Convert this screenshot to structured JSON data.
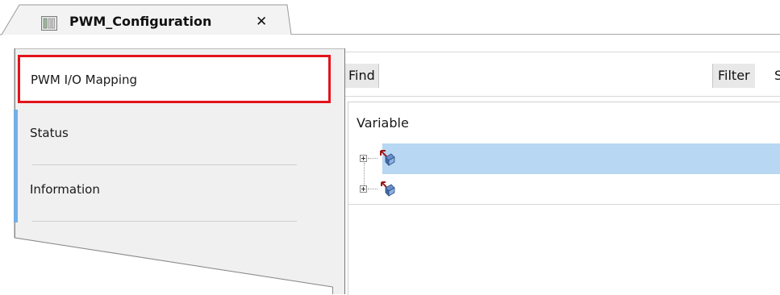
{
  "editor": {
    "tab_title": "PWM_Configuration",
    "tab_icon": "device-config-icon",
    "close_icon": "close-icon"
  },
  "side_tabs": [
    {
      "label": "PWM I/O Mapping",
      "active": true
    },
    {
      "label": "Status",
      "active": false
    },
    {
      "label": "Information",
      "active": false
    }
  ],
  "toolbar": {
    "find_label": "Find",
    "find_value": "",
    "filter_label": "Filter",
    "filter_value": "S"
  },
  "grid": {
    "column_header": "Variable",
    "rows": [
      {
        "icon": "output-channel-icon",
        "selected": true,
        "expander_icon": "expand-plus-icon"
      },
      {
        "icon": "input-channel-icon",
        "selected": false,
        "expander_icon": "expand-plus-icon"
      }
    ]
  },
  "colors": {
    "active_tab_border": "#e3141b",
    "side_tab_accent": "#6fb0e8",
    "selected_row": "#b7d7f2"
  }
}
